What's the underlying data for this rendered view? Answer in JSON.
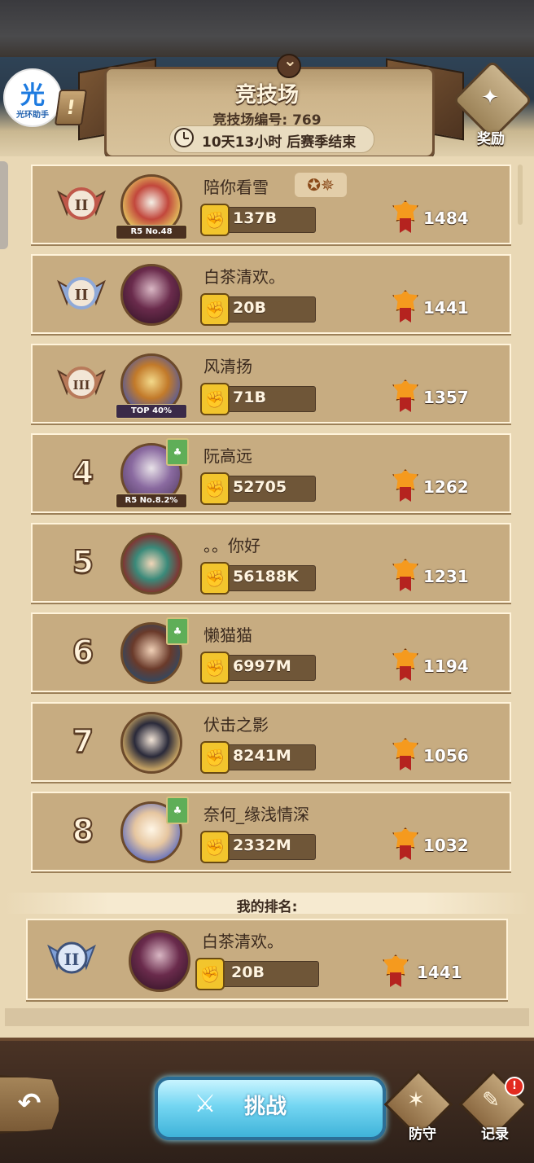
{
  "header": {
    "title": "竞技场",
    "arena_number": "竞技场编号: 769",
    "season_remaining": "10天13小时 后赛季结束",
    "reward_label": "奖励"
  },
  "logo": {
    "char": "光",
    "sub": "光环助手"
  },
  "rows": [
    {
      "rank": "",
      "name": "陪你看雪",
      "power": "137B",
      "score": "1484",
      "tag": "R5 No.48",
      "badge_color": "#c0584a"
    },
    {
      "rank": "",
      "name": "白茶清欢。",
      "power": "20B",
      "score": "1441",
      "tag": "",
      "badge_color": "#8fa9d8"
    },
    {
      "rank": "",
      "name": "风清扬",
      "power": "71B",
      "score": "1357",
      "tag": "TOP 40%",
      "badge_color": "#b87a5a"
    },
    {
      "rank": "4",
      "name": "阮高远",
      "power": "52705",
      "score": "1262",
      "tag": "R5 No.8.2%"
    },
    {
      "rank": "5",
      "name": "。。你好",
      "power": "56188K",
      "score": "1231",
      "tag": ""
    },
    {
      "rank": "6",
      "name": "懒猫猫",
      "power": "6997M",
      "score": "1194",
      "tag": ""
    },
    {
      "rank": "7",
      "name": "伏击之影",
      "power": "8241M",
      "score": "1056",
      "tag": ""
    },
    {
      "rank": "8",
      "name": "奈何_缘浅情深",
      "power": "2332M",
      "score": "1032",
      "tag": ""
    }
  ],
  "my_rank": {
    "label": "我的排名:",
    "name": "白茶清欢。",
    "power": "20B",
    "score": "1441"
  },
  "footer": {
    "challenge_label": "挑战",
    "defense_label": "防守",
    "record_label": "记录",
    "record_badge": "!"
  },
  "icons": {
    "back": "back-arrow-icon",
    "power": "fist-icon",
    "score": "medal-icon",
    "challenge": "crossed-swords-icon"
  },
  "colors": {
    "parchment": "#e9d8b5",
    "row": "#c7ac81",
    "challenge": "#74d6f2",
    "power_icon": "#f2c52d",
    "medal": "#f59a1e"
  }
}
